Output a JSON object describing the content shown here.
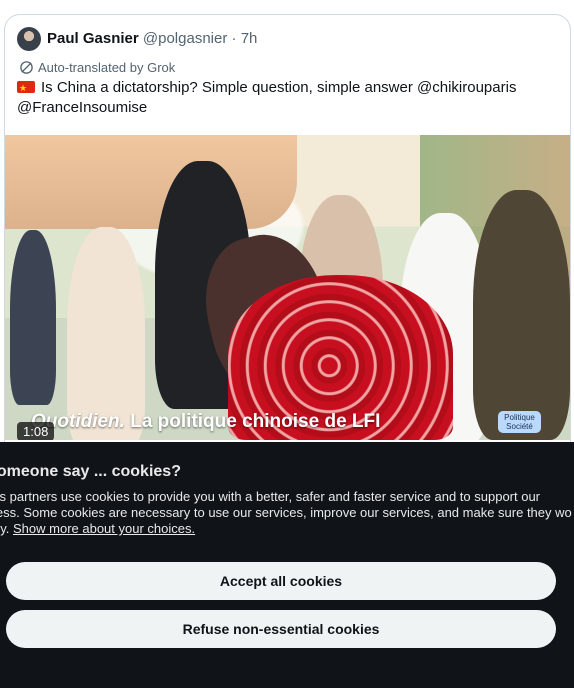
{
  "tweet": {
    "author_name": "Paul Gasnier",
    "handle": "@polgasnier",
    "separator": "·",
    "time": "7h",
    "translation_notice": "Auto-translated by Grok",
    "text": "Is China a dictatorship? Simple question, simple answer @chikirouparis @FranceInsoumise"
  },
  "video": {
    "duration": "1:08",
    "caption_brand": "Quotidien.",
    "caption_text": "La politique chinoise de LFI",
    "badge_line1": "Politique",
    "badge_line2": "Société"
  },
  "cookie": {
    "title": "someone say ... cookies?",
    "body": "its partners use cookies to provide you with a better, safer and faster service and to support our\nless. Some cookies are necessary to use our services, improve our services, and make sure they wo\nrly.",
    "more_link": "Show more about your choices.",
    "accept_label": "Accept all cookies",
    "refuse_label": "Refuse non-essential cookies"
  },
  "colors": {
    "text": "#0f1419",
    "muted": "#536471",
    "cookie_background": "#101418",
    "cookie_button": "#eff3f4"
  },
  "icons": [
    "avatar",
    "translate-icon",
    "china-flag-icon"
  ]
}
